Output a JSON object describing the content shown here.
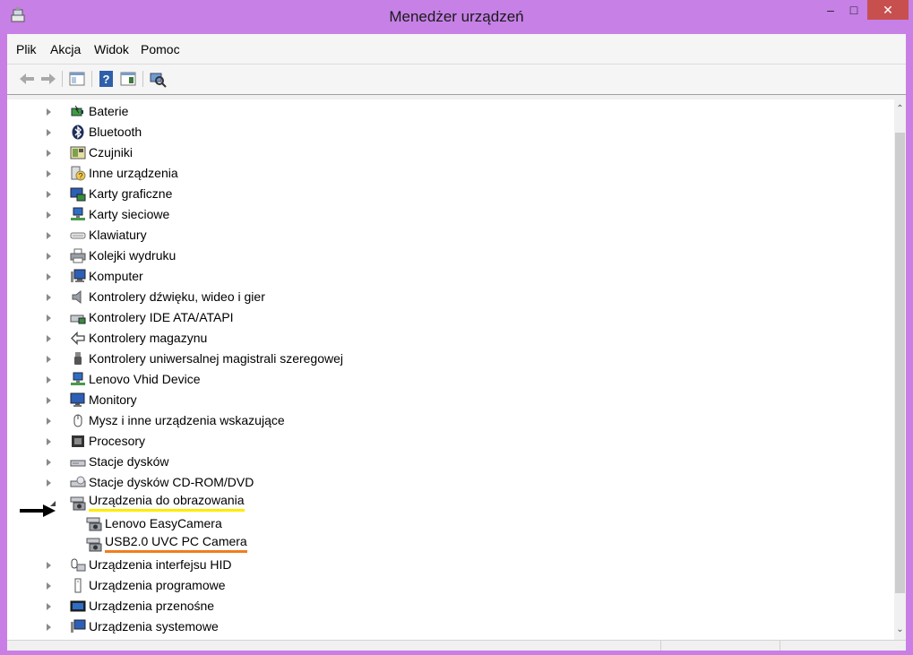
{
  "window": {
    "title": "Menedżer urządzeń",
    "minimize_glyph": "–",
    "maximize_glyph": "□",
    "close_glyph": "✕"
  },
  "menubar": {
    "items": [
      "Plik",
      "Akcja",
      "Widok",
      "Pomoc"
    ]
  },
  "toolbar": {
    "buttons": [
      "back-icon",
      "forward-icon",
      "show-hide-console-tree-icon",
      "help-icon",
      "properties-icon",
      "scan-hardware-icon"
    ]
  },
  "tree": {
    "nodes": [
      {
        "label": "Baterie",
        "icon": "battery-icon"
      },
      {
        "label": "Bluetooth",
        "icon": "bluetooth-icon"
      },
      {
        "label": "Czujniki",
        "icon": "sensor-icon"
      },
      {
        "label": "Inne urządzenia",
        "icon": "unknown-device-icon"
      },
      {
        "label": "Karty graficzne",
        "icon": "display-adapter-icon"
      },
      {
        "label": "Karty sieciowe",
        "icon": "network-adapter-icon"
      },
      {
        "label": "Klawiatury",
        "icon": "keyboard-icon"
      },
      {
        "label": "Kolejki wydruku",
        "icon": "printer-icon"
      },
      {
        "label": "Komputer",
        "icon": "computer-icon"
      },
      {
        "label": "Kontrolery dźwięku, wideo i gier",
        "icon": "speaker-icon"
      },
      {
        "label": "Kontrolery IDE ATA/ATAPI",
        "icon": "ide-controller-icon"
      },
      {
        "label": "Kontrolery magazynu",
        "icon": "storage-controller-icon"
      },
      {
        "label": "Kontrolery uniwersalnej magistrali szeregowej",
        "icon": "usb-icon"
      },
      {
        "label": "Lenovo Vhid Device",
        "icon": "network-adapter-icon"
      },
      {
        "label": "Monitory",
        "icon": "monitor-icon"
      },
      {
        "label": "Mysz i inne urządzenia wskazujące",
        "icon": "mouse-icon"
      },
      {
        "label": "Procesory",
        "icon": "processor-icon"
      },
      {
        "label": "Stacje dysków",
        "icon": "disk-drive-icon"
      },
      {
        "label": "Stacje dysków CD-ROM/DVD",
        "icon": "cdrom-icon"
      },
      {
        "label": "Urządzenia do obrazowania",
        "icon": "camera-icon",
        "expanded": true
      },
      {
        "label": "Lenovo EasyCamera",
        "icon": "camera-icon",
        "child": true
      },
      {
        "label": "USB2.0 UVC PC Camera",
        "icon": "camera-icon",
        "child": true
      },
      {
        "label": "Urządzenia interfejsu HID",
        "icon": "hid-icon"
      },
      {
        "label": "Urządzenia programowe",
        "icon": "software-device-icon"
      },
      {
        "label": "Urządzenia przenośne",
        "icon": "portable-device-icon"
      },
      {
        "label": "Urządzenia systemowe",
        "icon": "system-device-icon"
      }
    ]
  },
  "colors": {
    "window_frame": "#c97ee6",
    "close_button": "#c7504f",
    "highlight_yellow": "#ffeb00",
    "highlight_orange": "#f07d1e"
  }
}
